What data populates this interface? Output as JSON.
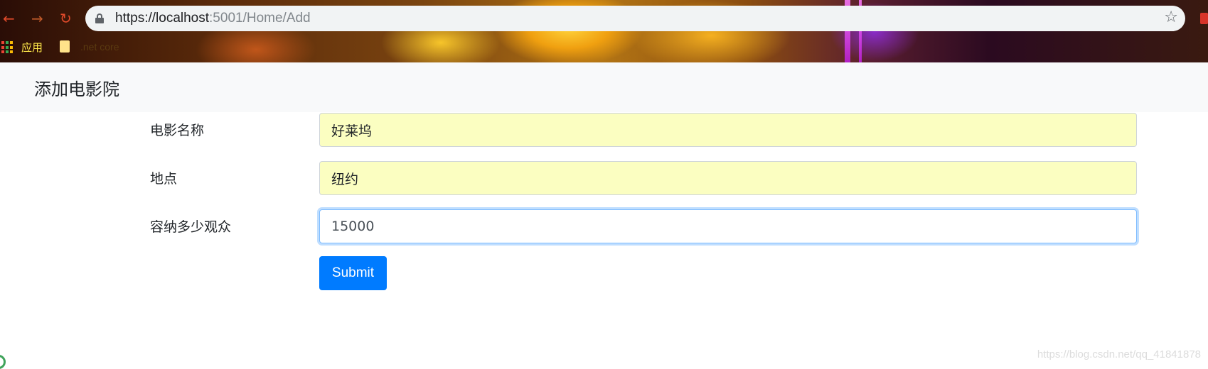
{
  "browser": {
    "url_host": "https://localhost",
    "url_rest": ":5001/Home/Add",
    "bookmarks": {
      "apps_label": "应用",
      "folder_label": ".net core"
    }
  },
  "navbar": {
    "title": "添加电影院"
  },
  "form": {
    "fields": [
      {
        "label": "电影名称",
        "value": "好莱坞"
      },
      {
        "label": "地点",
        "value": "纽约"
      },
      {
        "label": "容纳多少观众",
        "value": "15000"
      }
    ],
    "submit_label": "Submit"
  },
  "watermark": "https://blog.csdn.net/qq_41841878"
}
